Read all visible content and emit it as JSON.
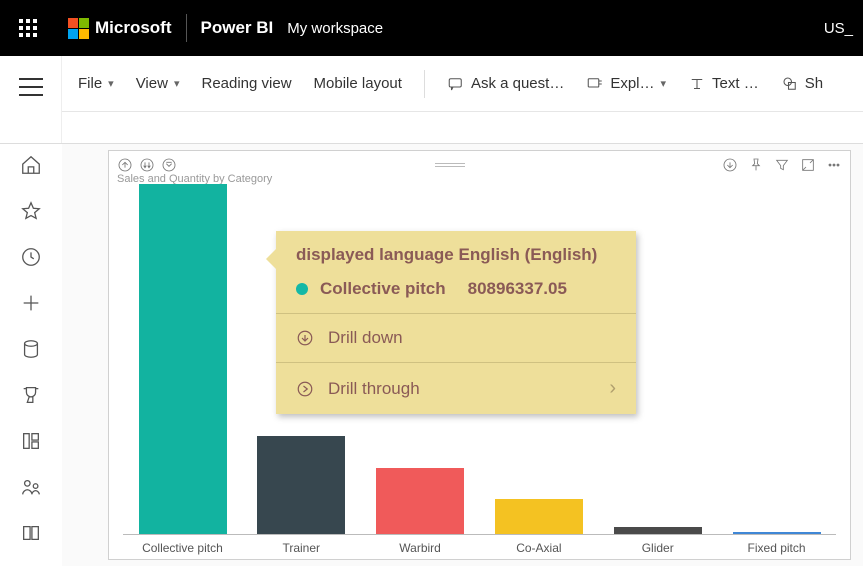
{
  "topbar": {
    "company": "Microsoft",
    "app": "Power BI",
    "workspace": "My workspace",
    "user": "US_"
  },
  "ribbon": {
    "file": "File",
    "view": "View",
    "reading_view": "Reading view",
    "mobile": "Mobile layout",
    "qna": "Ask a quest…",
    "explore": "Expl…",
    "textbox": "Text …",
    "shapes": "Sh"
  },
  "visual": {
    "title": "Sales and Quantity by Category"
  },
  "chart_data": {
    "type": "bar",
    "title": "Sales and Quantity by Category",
    "xlabel": "",
    "ylabel": "",
    "categories": [
      "Collective pitch",
      "Trainer",
      "Warbird",
      "Co-Axial",
      "Glider",
      "Fixed pitch"
    ],
    "values_relative": [
      100,
      28,
      19,
      10,
      2,
      0.5
    ],
    "colors": [
      "#12b3a0",
      "#37474f",
      "#f05a5a",
      "#f4c222",
      "#4a4a4a",
      "#3f87d6"
    ],
    "tooltip_value": 80896337.05
  },
  "tooltip": {
    "header": "displayed language English (English)",
    "series_label": "Collective pitch",
    "value": "80896337.05",
    "drill_down": "Drill down",
    "drill_through": "Drill through"
  }
}
